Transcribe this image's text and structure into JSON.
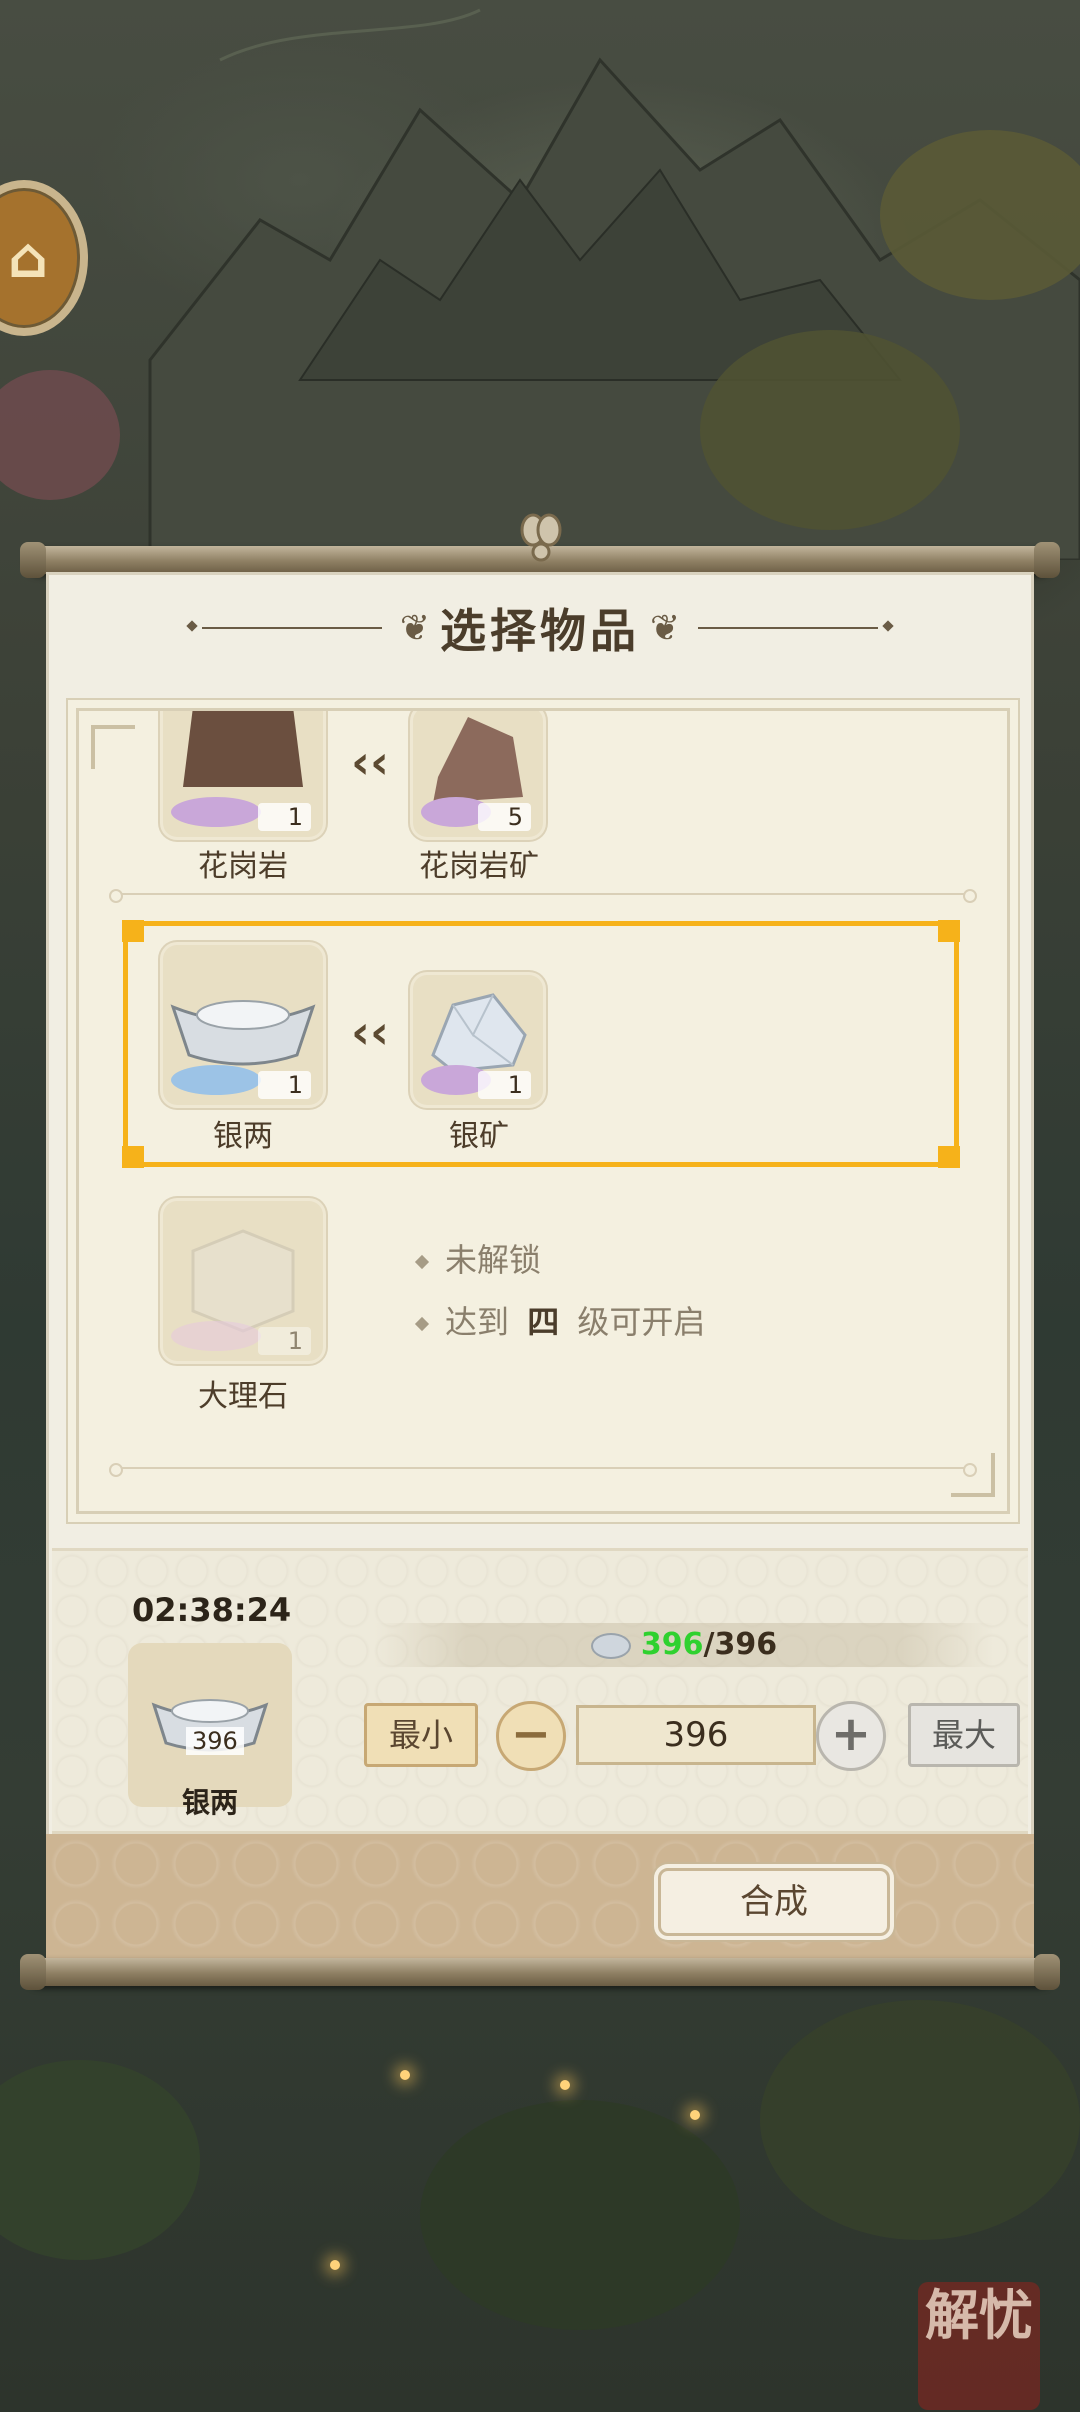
{
  "dialog": {
    "title": "选择物品"
  },
  "recipes": [
    {
      "output": {
        "name": "花岗岩",
        "count": "1",
        "icon": "granite-icon"
      },
      "input": {
        "name": "花岗岩矿",
        "count": "5",
        "icon": "granite-ore-icon"
      }
    },
    {
      "output": {
        "name": "银两",
        "count": "1",
        "icon": "silver-ingot-icon"
      },
      "input": {
        "name": "银矿",
        "count": "1",
        "icon": "silver-ore-icon"
      },
      "selected": true
    },
    {
      "output": {
        "name": "大理石",
        "count": "1",
        "icon": "marble-icon"
      },
      "locked": {
        "status": "未解锁",
        "req_prefix": "达到",
        "req_level": "四",
        "req_suffix": "级可开启"
      }
    }
  ],
  "craft": {
    "timer": "02:38:24",
    "output_name": "银两",
    "output_count": "396",
    "stock_have": "396",
    "stock_sep": "/",
    "stock_need": "396",
    "min_label": "最小",
    "max_label": "最大",
    "quantity": "396",
    "craft_label": "合成"
  },
  "seal_text": "解忧",
  "colors": {
    "highlight": "#f6b21a",
    "stock_green": "#2fd12f",
    "panel": "#f1eee3"
  }
}
